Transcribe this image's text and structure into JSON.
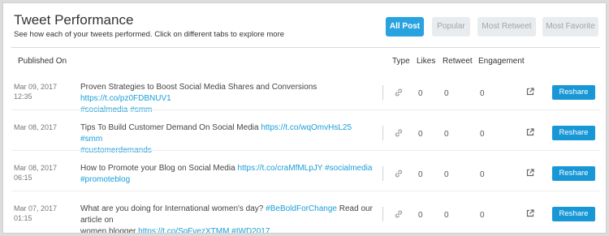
{
  "header": {
    "title": "Tweet Performance",
    "subtitle": "See how each of your tweets performed. Click on different tabs to explore more"
  },
  "tabs": [
    {
      "label": "All Post",
      "active": true
    },
    {
      "label": "Popular",
      "active": false
    },
    {
      "label": "Most Retweet",
      "active": false
    },
    {
      "label": "Most Favorite",
      "active": false
    }
  ],
  "columns": {
    "published_on": "Published On",
    "type": "Type",
    "likes": "Likes",
    "retweet": "Retweet",
    "engagement": "Engagement"
  },
  "rows": [
    {
      "date": "Mar 09, 2017",
      "time": "12:35",
      "line1": [
        {
          "t": "Proven Strategies to Boost Social Media Shares and Conversions ",
          "link": false
        },
        {
          "t": "https://t.co/pz0FDBNUV1",
          "link": true
        }
      ],
      "line2": [
        {
          "t": "#socialmedia #smm",
          "link": true
        }
      ],
      "likes": "0",
      "retweet": "0",
      "engagement": "0",
      "reshare_label": "Reshare"
    },
    {
      "date": "Mar 08, 2017",
      "time": "",
      "line1": [
        {
          "t": "Tips To Build Customer Demand On Social Media ",
          "link": false
        },
        {
          "t": "https://t.co/wqOmvHsL25 #smm",
          "link": true
        }
      ],
      "line2": [
        {
          "t": "#customerdemands",
          "link": true
        }
      ],
      "likes": "0",
      "retweet": "0",
      "engagement": "0",
      "reshare_label": "Reshare"
    },
    {
      "date": "Mar 08, 2017",
      "time": "06:15",
      "line1": [
        {
          "t": "How to Promote your Blog on Social Media ",
          "link": false
        },
        {
          "t": "https://t.co/craMfMLpJY #socialmedia",
          "link": true
        }
      ],
      "line2": [
        {
          "t": "#promoteblog",
          "link": true
        }
      ],
      "likes": "0",
      "retweet": "0",
      "engagement": "0",
      "reshare_label": "Reshare"
    },
    {
      "date": "Mar 07, 2017",
      "time": "01:15",
      "line1": [
        {
          "t": "What are you doing for International women's day? ",
          "link": false
        },
        {
          "t": "#BeBoldForChange",
          "link": true
        },
        {
          "t": " Read our article on",
          "link": false
        }
      ],
      "line2": [
        {
          "t": "women blogger ",
          "link": false
        },
        {
          "t": "https://t.co/SgFvezXTMM #IWD2017",
          "link": true
        }
      ],
      "likes": "0",
      "retweet": "0",
      "engagement": "0",
      "reshare_label": "Reshare"
    }
  ],
  "icons": {
    "type": "link-icon",
    "external": "external-link-icon"
  },
  "colors": {
    "accent": "#29a3e0",
    "link": "#1a9ed8",
    "button": "#1897d6",
    "tab_inactive_bg": "#e8ecef"
  }
}
